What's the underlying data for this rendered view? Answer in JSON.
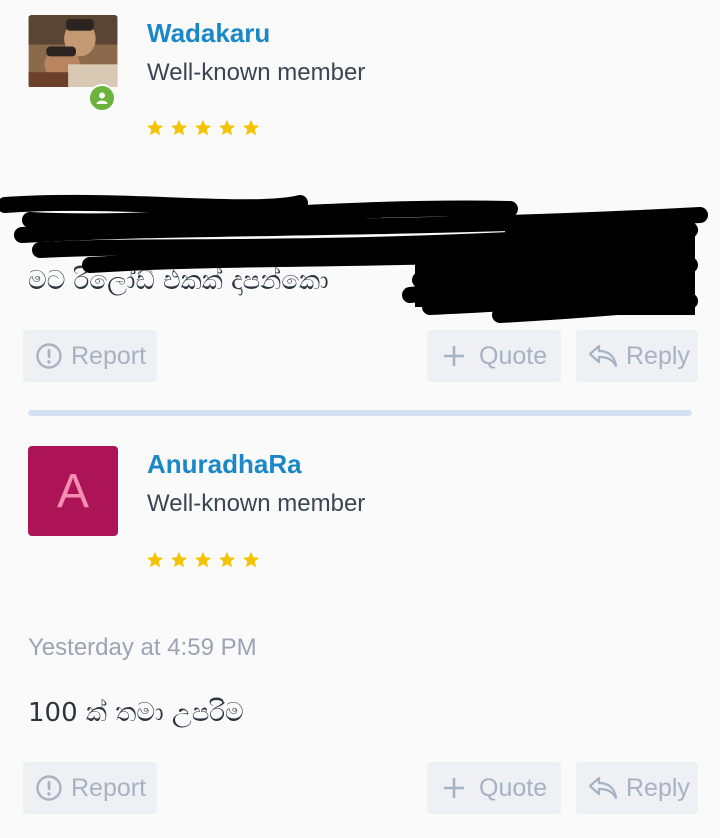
{
  "posts": [
    {
      "username": "Wadakaru",
      "user_title": "Well-known member",
      "avatar": "photo-avatar",
      "online": true,
      "stars": 5,
      "timestamp": "",
      "message_visible": "මට රිලෝඩ් එකක් දාපන්කො",
      "message_redacted": true
    },
    {
      "username": "AnuradhaRa",
      "user_title": "Well-known member",
      "avatar_letter": "A",
      "stars": 5,
      "timestamp": "Yesterday at 4:59 PM",
      "message_visible": "100 ක් තමා උපරිම"
    }
  ],
  "actions": {
    "report": "Report",
    "quote": "Quote",
    "reply": "Reply"
  },
  "colors": {
    "username": "#1a87c8",
    "star": "#f5c400",
    "online": "#6cb33e",
    "avatar_bg": "#ad1457",
    "avatar_letter": "#f48fb1",
    "button_bg": "#eef0f4",
    "button_text": "#a7b2c3",
    "divider": "#d4e1f4"
  }
}
